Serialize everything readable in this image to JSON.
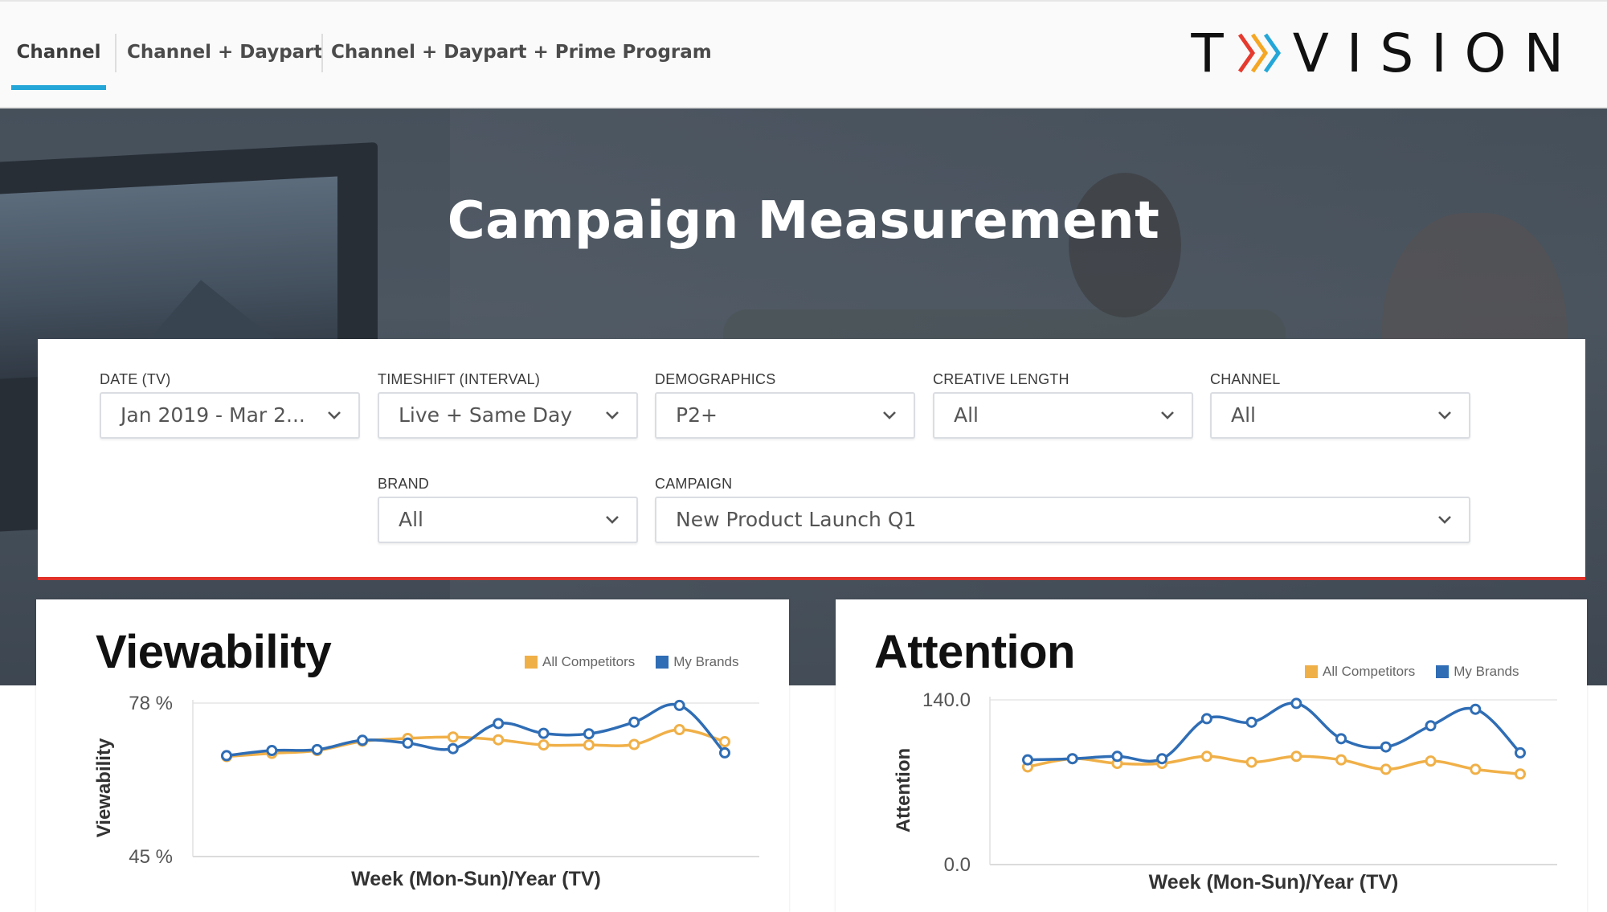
{
  "nav": {
    "tabs": [
      {
        "label": "Channel",
        "active": true
      },
      {
        "label": "Channel + Daypart",
        "active": false
      },
      {
        "label": "Channel + Daypart + Prime Program",
        "active": false
      }
    ],
    "logo_text": "TVISION",
    "logo_colors": [
      "#e63a2e",
      "#f5a623",
      "#24a7d8"
    ]
  },
  "hero": {
    "title": "Campaign Measurement"
  },
  "filters": {
    "date": {
      "label": "DATE (TV)",
      "value": "Jan 2019 - Mar 2..."
    },
    "timeshift": {
      "label": "TIMESHIFT (INTERVAL)",
      "value": "Live + Same Day"
    },
    "demographics": {
      "label": "DEMOGRAPHICS",
      "value": "P2+"
    },
    "creative_length": {
      "label": "CREATIVE LENGTH",
      "value": "All"
    },
    "channel": {
      "label": "CHANNEL",
      "value": "All"
    },
    "brand": {
      "label": "BRAND",
      "value": "All"
    },
    "campaign": {
      "label": "CAMPAIGN",
      "value": "New Product Launch Q1"
    }
  },
  "colors": {
    "competitors": "#f0b048",
    "my_brands": "#2f6db5",
    "accent_tab": "#24a7d8",
    "filter_border": "#e0322a"
  },
  "chart_data": [
    {
      "type": "line",
      "title": "Viewability",
      "xlabel": "Week (Mon-Sun)/Year (TV)",
      "ylabel": "Viewability",
      "y_tick_labels": [
        "78 %",
        "45 %"
      ],
      "ylim": [
        45,
        78
      ],
      "legend": "top-right",
      "grid": true,
      "series": [
        {
          "name": "All Competitors",
          "color": "#f0b048",
          "values": [
            66.5,
            67.2,
            67.8,
            69.8,
            70.4,
            70.7,
            70.1,
            69.0,
            69.0,
            69.1,
            72.3,
            69.7
          ]
        },
        {
          "name": "My Brands",
          "color": "#2f6db5",
          "values": [
            66.7,
            67.8,
            68.0,
            70.0,
            69.4,
            68.2,
            73.6,
            71.5,
            71.4,
            73.9,
            77.5,
            67.3
          ]
        }
      ]
    },
    {
      "type": "line",
      "title": "Attention",
      "xlabel": "Week (Mon-Sun)/Year (TV)",
      "ylabel": "Attention",
      "y_tick_labels": [
        "140.0",
        "0.0"
      ],
      "ylim": [
        0,
        140
      ],
      "legend": "top-right",
      "grid": true,
      "series": [
        {
          "name": "All Competitors",
          "color": "#f0b048",
          "values": [
            83,
            90,
            86,
            86,
            92,
            87,
            92,
            89,
            81,
            88,
            81,
            77
          ]
        },
        {
          "name": "My Brands",
          "color": "#2f6db5",
          "values": [
            89,
            90,
            92,
            90,
            124,
            121,
            137,
            107,
            100,
            118,
            132,
            95
          ]
        }
      ]
    }
  ]
}
